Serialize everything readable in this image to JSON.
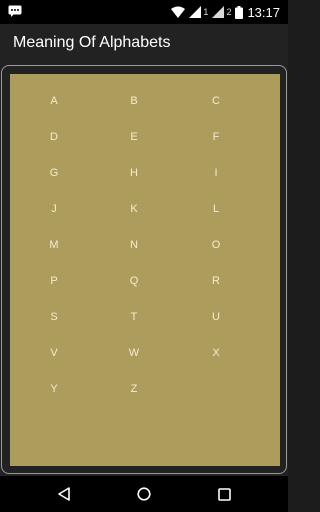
{
  "status_bar": {
    "sim1": "1",
    "sim2": "2",
    "time": "13:17"
  },
  "app": {
    "title": "Meaning Of Alphabets"
  },
  "letters": [
    "A",
    "B",
    "C",
    "D",
    "E",
    "F",
    "G",
    "H",
    "I",
    "J",
    "K",
    "L",
    "M",
    "N",
    "O",
    "P",
    "Q",
    "R",
    "S",
    "T",
    "U",
    "V",
    "W",
    "X",
    "Y",
    "Z"
  ],
  "colors": {
    "board": "#ad9d5c",
    "letter": "#f3ecd2",
    "background": "#222222"
  },
  "nav": {
    "back": "back-icon",
    "home": "home-icon",
    "recents": "recents-icon"
  }
}
